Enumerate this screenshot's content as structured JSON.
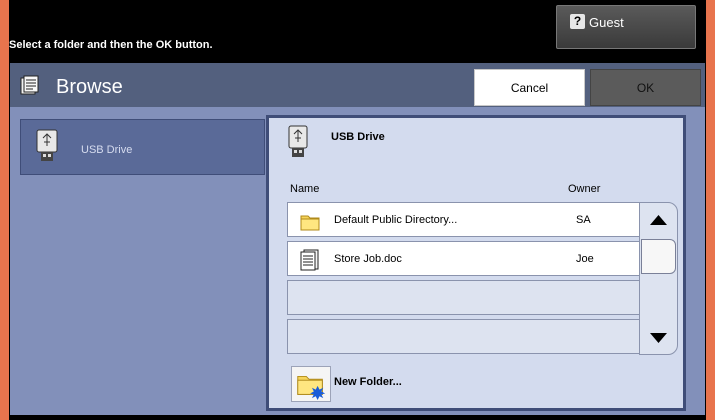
{
  "header": {
    "instruction": "Select a folder and then the OK button.",
    "user_button_label": "Guest"
  },
  "browse": {
    "title": "Browse",
    "cancel_label": "Cancel",
    "ok_label": "OK"
  },
  "sidebar": {
    "items": [
      {
        "label": "USB Drive",
        "icon": "usb-drive-icon",
        "selected": true
      }
    ]
  },
  "panel": {
    "title": "USB Drive",
    "columns": [
      "Name",
      "Owner"
    ],
    "rows": [
      {
        "name": "Default Public Directory...",
        "owner": "SA",
        "icon": "folder-icon"
      },
      {
        "name": "Store Job.doc",
        "owner": "Joe",
        "icon": "document-icon"
      },
      {
        "name": "",
        "owner": ""
      },
      {
        "name": "",
        "owner": ""
      }
    ],
    "new_folder_label": "New Folder..."
  },
  "colors": {
    "background_frame": "#e8744d",
    "header_bar": "#53607e",
    "main_area": "#8290ba",
    "panel": "#d3dbee",
    "selected_item": "#5a6a98"
  }
}
